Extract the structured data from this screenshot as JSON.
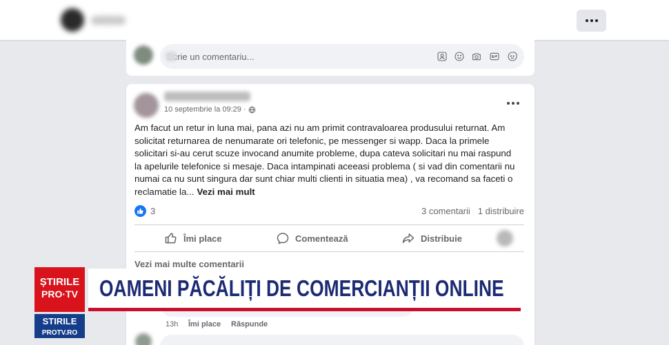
{
  "header": {
    "more_icon": "more-icon"
  },
  "comment_composer": {
    "placeholder": "Scrie un comentariu...",
    "icons": [
      "avatar-sticker-icon",
      "emoji-icon",
      "camera-icon",
      "gif-icon",
      "sticker-icon"
    ]
  },
  "post": {
    "more_icon": "more-icon",
    "timestamp": "10 septembrie la 09:29",
    "separator": "·",
    "privacy_icon": "globe-icon",
    "body": [
      "Am facut un retur in luna mai, pana azi nu am primit contravaloarea produsului returnat. Am",
      "solicitat returnarea de nenumarate ori telefonic, pe messenger si wapp. Daca la primele",
      "solicitari si-au cerut scuze invocand anumite probleme, dupa cateva solicitari nu mai raspund",
      "la apelurile telefonice si mesaje. Daca intampinati aceeasi problema ( si vad din comentarii nu",
      "numai ca nu sunt singura dar sunt chiar multi clienti in situatia mea) , va recomand sa faceti o",
      "reclamatie la..."
    ],
    "see_more": "Vezi mai mult",
    "reactions": {
      "icon": "like-reaction-icon",
      "count": "3"
    },
    "comments_count": "3 comentarii",
    "shares_count": "1 distribuire",
    "actions": {
      "like": "Îmi place",
      "comment": "Comentează",
      "share": "Distribuie"
    },
    "view_more_comments": "Vezi mai multe comentarii"
  },
  "comment": {
    "time": "13h",
    "like": "Îmi place",
    "reply": "Răspunde"
  },
  "broadcast": {
    "logo": {
      "line1": "ȘTIRILE",
      "line2": "PRO·TV"
    },
    "site_logo": {
      "line1": "STIRILE",
      "line2": "PROTV.RO"
    },
    "headline": "OAMENI PĂCĂLIȚI DE COMERCIANȚII ONLINE"
  },
  "colors": {
    "facebook_blue": "#1877f2",
    "page_bg": "#e7e9ec",
    "protv_red": "#d8131b",
    "protv_blue": "#153d8a",
    "headline_navy": "#1b2a73",
    "headline_rule_red": "#c8102e"
  }
}
